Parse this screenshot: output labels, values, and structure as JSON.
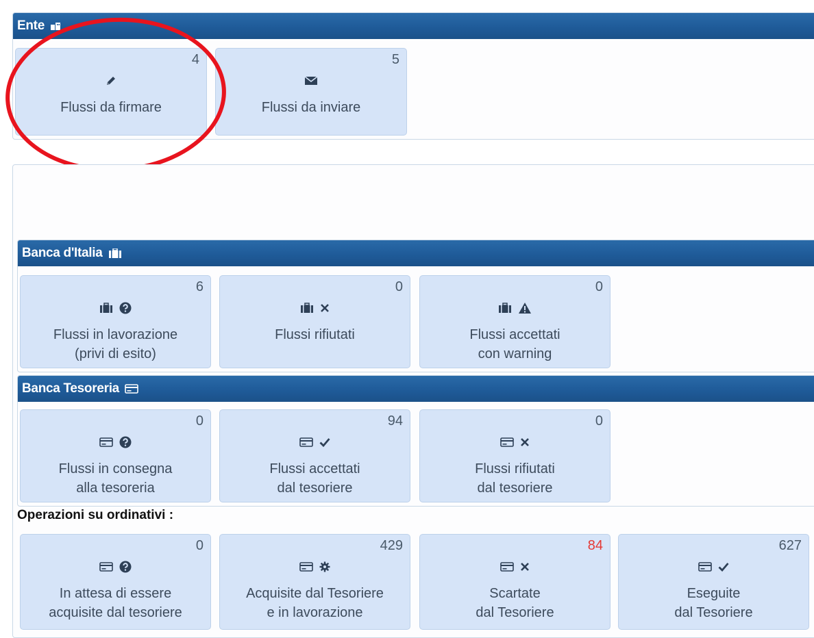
{
  "ente": {
    "header": "Ente",
    "header_icon": "building-icon",
    "tiles": [
      {
        "count": "4",
        "icons": [
          "pencil-icon"
        ],
        "label": "Flussi da firmare"
      },
      {
        "count": "5",
        "icons": [
          "envelope-icon"
        ],
        "label": "Flussi da inviare"
      }
    ]
  },
  "banca_italia": {
    "header": "Banca d'Italia",
    "header_icon": "briefcase-icon",
    "tiles": [
      {
        "count": "6",
        "icons": [
          "briefcase-icon",
          "question-circle-icon"
        ],
        "label": "Flussi in lavorazione\n(privi di esito)"
      },
      {
        "count": "0",
        "icons": [
          "briefcase-icon",
          "times-icon"
        ],
        "label": "Flussi rifiutati"
      },
      {
        "count": "0",
        "icons": [
          "briefcase-icon",
          "warning-icon"
        ],
        "label": "Flussi accettati\ncon warning"
      }
    ]
  },
  "banca_tesoreria": {
    "header": "Banca Tesoreria",
    "header_icon": "credit-card-icon",
    "tiles": [
      {
        "count": "0",
        "icons": [
          "credit-card-icon",
          "question-circle-icon"
        ],
        "label": "Flussi in consegna\nalla tesoreria"
      },
      {
        "count": "94",
        "icons": [
          "credit-card-icon",
          "check-icon"
        ],
        "label": "Flussi accettati\ndal tesoriere"
      },
      {
        "count": "0",
        "icons": [
          "credit-card-icon",
          "times-icon"
        ],
        "label": "Flussi rifiutati\ndal tesoriere"
      }
    ]
  },
  "operazioni": {
    "title": "Operazioni su ordinativi :",
    "tiles": [
      {
        "count": "0",
        "icons": [
          "credit-card-icon",
          "question-circle-icon"
        ],
        "label": "In attesa di essere\nacquisite dal tesoriere"
      },
      {
        "count": "429",
        "icons": [
          "credit-card-icon",
          "gear-icon"
        ],
        "label": "Acquisite dal Tesoriere\ne in lavorazione"
      },
      {
        "count": "84",
        "icons": [
          "credit-card-icon",
          "times-icon"
        ],
        "label": "Scartate\ndal Tesoriere",
        "count_color": "#e53935"
      },
      {
        "count": "627",
        "icons": [
          "credit-card-icon",
          "check-icon"
        ],
        "label": "Eseguite\ndal Tesoriere"
      }
    ]
  },
  "colors": {
    "header_blue": "#1f5b99",
    "tile_bg": "#d6e4f8",
    "highlight_ring": "#e8141e"
  }
}
